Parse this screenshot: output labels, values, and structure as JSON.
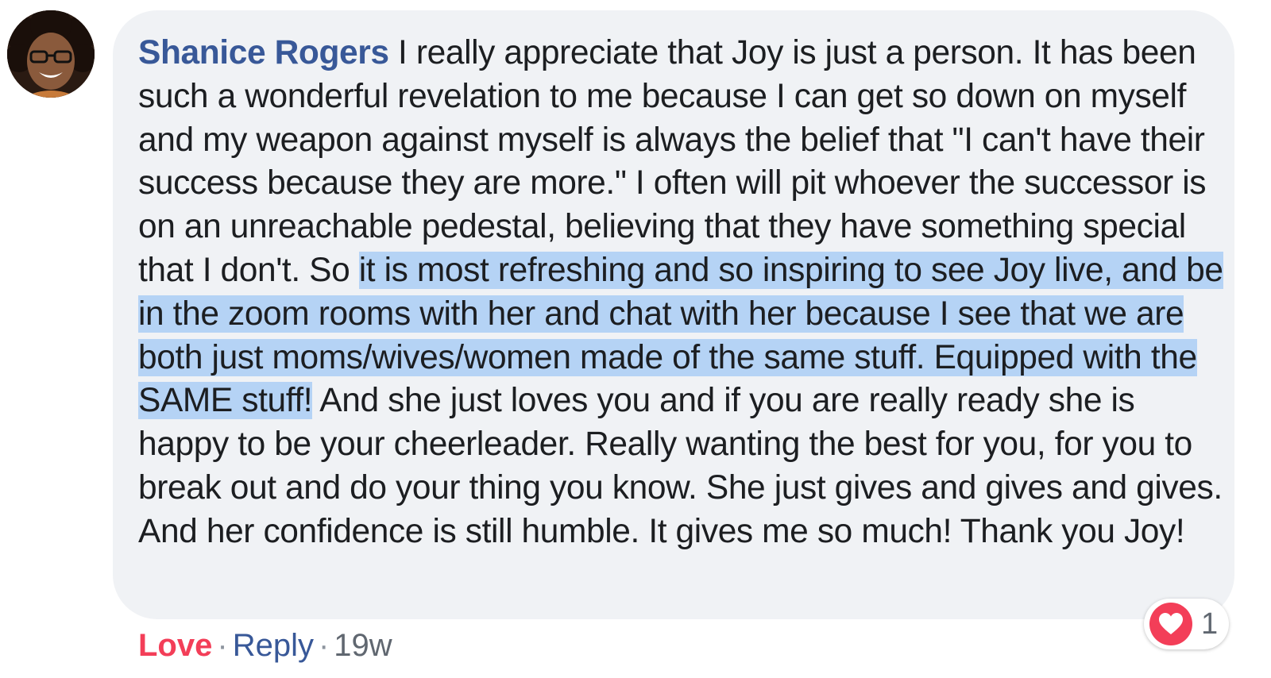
{
  "comment": {
    "author": "Shanice Rogers",
    "text_before_highlight": " I really appreciate that Joy is just a person. It has been such a wonderful revelation to me because I can get so down on myself and my weapon against myself is always the belief that \"I can't have their success because they are more.\" I often will pit whoever the successor is on an unreachable pedestal, believing that they have something special that I don't. So ",
    "text_highlighted": "it is most refreshing and so inspiring to see Joy live, and be in the zoom rooms with her and chat with her because I see that we are both just moms/wives/women made of the same stuff. Equipped with the SAME stuff!",
    "text_after_highlight": " And she just loves you and if you are really ready she is happy to be your cheerleader. Really wanting the best for you, for you to break out and do your thing you know. She just gives and gives and gives. And her confidence is still humble. It gives me so much! Thank you Joy!",
    "highlight_color": "#b5d3f5"
  },
  "actions": {
    "love_label": "Love",
    "separator": "·",
    "reply_label": "Reply",
    "timestamp": "19w"
  },
  "reactions": {
    "icon": "heart-icon",
    "count": "1",
    "color": "#f33e58"
  },
  "colors": {
    "author_link": "#385898",
    "bubble_bg": "#f0f2f5",
    "love_red": "#f33e58"
  }
}
